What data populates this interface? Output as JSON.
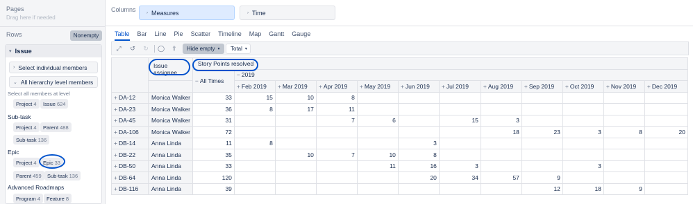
{
  "left": {
    "pages_title": "Pages",
    "pages_hint": "Drag here if needed",
    "rows_title": "Rows",
    "nonempty_label": "Nonempty",
    "issue_title": "Issue",
    "select_individual": "Select individual members",
    "all_hierarchy": "All hierarchy level members",
    "select_all_hint": "Select all members at level",
    "chips_row1": [
      {
        "label": "Project",
        "count": "4"
      },
      {
        "label": "Issue",
        "count": "624"
      }
    ],
    "subtask_label": "Sub-task",
    "chips_subtask": [
      {
        "label": "Project",
        "count": "4"
      },
      {
        "label": "Parent",
        "count": "488"
      },
      {
        "label": "Sub-task",
        "count": "136"
      }
    ],
    "epic_label": "Epic",
    "chips_epic": [
      {
        "label": "Project",
        "count": "4"
      },
      {
        "label": "Epic",
        "count": "33"
      },
      {
        "label": "Parent",
        "count": "459"
      },
      {
        "label": "Sub-task",
        "count": "136"
      }
    ],
    "adv_label": "Advanced Roadmaps",
    "chips_adv": [
      {
        "label": "Program",
        "count": "4"
      },
      {
        "label": "Feature",
        "count": "8"
      }
    ]
  },
  "columns": {
    "label": "Columns",
    "measures": "Measures",
    "time": "Time"
  },
  "tabs": [
    "Table",
    "Bar",
    "Line",
    "Pie",
    "Scatter",
    "Timeline",
    "Map",
    "Gantt",
    "Gauge"
  ],
  "toolbar": {
    "hide_empty": "Hide empty",
    "total": "Total"
  },
  "table": {
    "assignee_header": "Issue assignee",
    "measure_header": "Story Points resolved",
    "year_header": "2019",
    "all_times": "All Times",
    "months": [
      "Feb 2019",
      "Mar 2019",
      "Apr 2019",
      "May 2019",
      "Jun 2019",
      "Jul 2019",
      "Aug 2019",
      "Sep 2019",
      "Oct 2019",
      "Nov 2019",
      "Dec 2019"
    ],
    "rows": [
      {
        "issue": "DA-12",
        "assignee": "Monica Walker",
        "all": "33",
        "m": [
          "15",
          "10",
          "8",
          "",
          "",
          "",
          "",
          "",
          "",
          "",
          ""
        ]
      },
      {
        "issue": "DA-23",
        "assignee": "Monica Walker",
        "all": "36",
        "m": [
          "8",
          "17",
          "11",
          "",
          "",
          "",
          "",
          "",
          "",
          "",
          ""
        ]
      },
      {
        "issue": "DA-45",
        "assignee": "Monica Walker",
        "all": "31",
        "m": [
          "",
          "",
          "7",
          "6",
          "",
          "15",
          "3",
          "",
          "",
          "",
          ""
        ]
      },
      {
        "issue": "DA-106",
        "assignee": "Monica Walker",
        "all": "72",
        "m": [
          "",
          "",
          "",
          "",
          "",
          "",
          "18",
          "23",
          "3",
          "8",
          "20"
        ]
      },
      {
        "issue": "DB-14",
        "assignee": "Anna Linda",
        "all": "11",
        "m": [
          "8",
          "",
          "",
          "",
          "3",
          "",
          "",
          "",
          "",
          "",
          ""
        ]
      },
      {
        "issue": "DB-22",
        "assignee": "Anna Linda",
        "all": "35",
        "m": [
          "",
          "10",
          "7",
          "10",
          "8",
          "",
          "",
          "",
          "",
          "",
          ""
        ]
      },
      {
        "issue": "DB-50",
        "assignee": "Anna Linda",
        "all": "33",
        "m": [
          "",
          "",
          "",
          "11",
          "16",
          "3",
          "",
          "",
          "3",
          "",
          ""
        ]
      },
      {
        "issue": "DB-64",
        "assignee": "Anna Linda",
        "all": "120",
        "m": [
          "",
          "",
          "",
          "",
          "20",
          "34",
          "57",
          "9",
          "",
          "",
          ""
        ]
      },
      {
        "issue": "DB-116",
        "assignee": "Anna Linda",
        "all": "39",
        "m": [
          "",
          "",
          "",
          "",
          "",
          "",
          "",
          "12",
          "18",
          "9",
          ""
        ]
      }
    ]
  }
}
